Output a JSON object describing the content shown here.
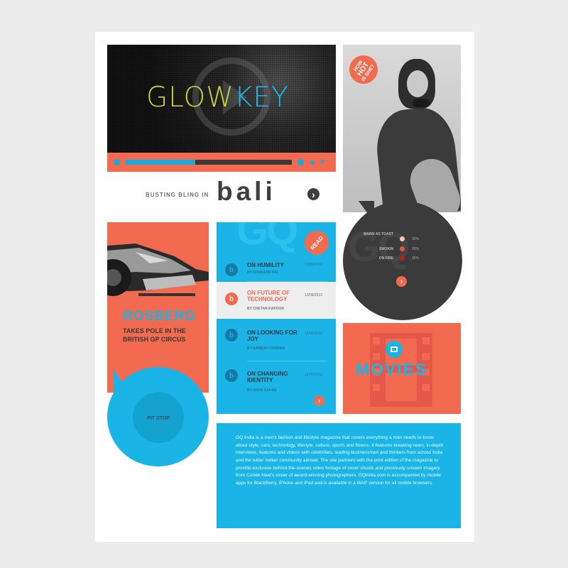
{
  "video": {
    "title_part1": "GLOW",
    "title_part2": "KEY",
    "progress": 0.42
  },
  "bali": {
    "kicker": "BUSTING BLING IN",
    "word": "bali",
    "arrow": "›"
  },
  "photo": {
    "badge_line1": "HOW",
    "badge_line2": "HOT",
    "badge_line3": "IS SHE?"
  },
  "gauge": {
    "watermark": "GQ",
    "rows": [
      {
        "label": "WARM AS TOAST",
        "pct": "35%",
        "color": "#f5c4bb"
      },
      {
        "label": "SMOKIN",
        "pct": "35%",
        "color": "#e8534c"
      },
      {
        "label": "ON FIRE",
        "pct": "35%",
        "color": "#c0201a"
      }
    ],
    "arrow": "›"
  },
  "rosberg": {
    "title": "ROSBERG",
    "subtitle": "TAKES POLE IN THE BRITISH GP CIRCUS",
    "pit_label": "PIT STOP"
  },
  "articles": {
    "watermark": "GQ",
    "read_badge": "READ",
    "icon_glyph": "b",
    "items": [
      {
        "title": "ON HUMILITY",
        "date": "12/06/2012",
        "byline": "BY SHAILESH RAI"
      },
      {
        "title": "ON FUTURE OF TECHNOLOGY",
        "date": "12/06/2012",
        "byline": "BY CHETAN KAPOOR"
      },
      {
        "title": "ON LOOKING FOR JOY",
        "date": "12/06/2012",
        "byline": "BY RAMESH SHARMA"
      },
      {
        "title": "ON CHANGING IDENTITY",
        "date": "12/06/2012",
        "byline": "BY ARUN SAHAA"
      }
    ],
    "arrow": "›"
  },
  "movies": {
    "title": "MOVIES"
  },
  "about": {
    "text": "GQ India is a men's fashion and lifestyle magazine that covers everything a man needs to know about style, cars, technology, lifestyle, culture, sports and fitness. It features breaking news, in-depth interviews, features and videos with celebrities, leading businessmen and thinkers from across India and the wider Indian community abroad. The site partners with the print edition of the magazine to provide exclusive behind-the-scenes video footage of cover shoots and previously unseen imagery from Conde Nast's roster of award-winning photographers. GQindia.com is accompanied by mobile apps for BlackBerry, iPhone and iPad and is available in a WAP version for all mobile browsers."
  },
  "colors": {
    "coral": "#f26a50",
    "cyan": "#1ab4e6",
    "charcoal": "#3b3b3b",
    "lime": "#c8d23a"
  }
}
